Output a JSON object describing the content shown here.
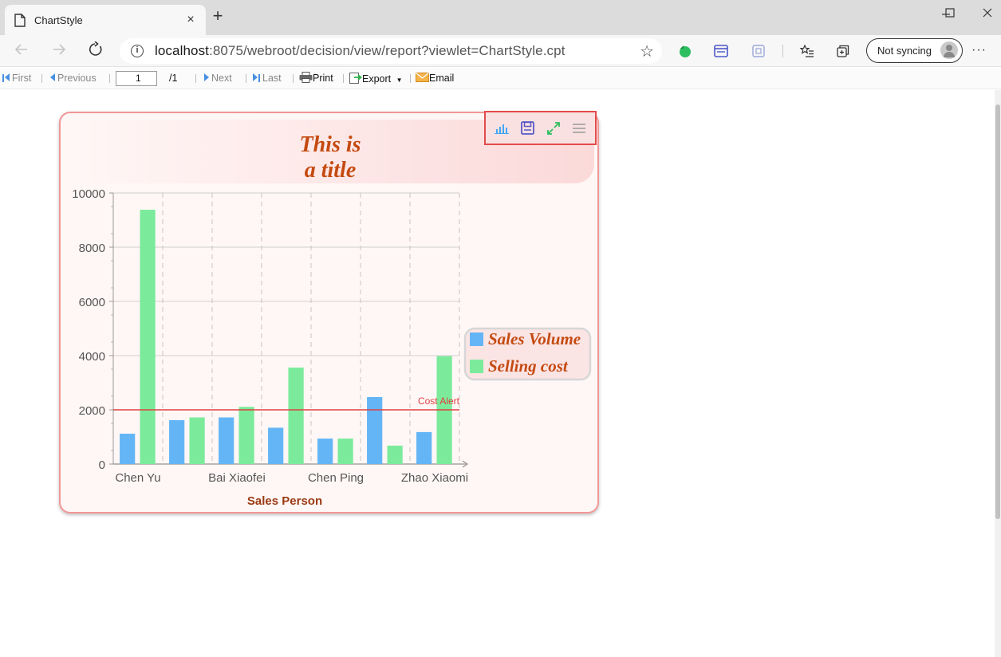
{
  "browser": {
    "tab_title": "ChartStyle",
    "tab_close": "×",
    "new_tab": "+",
    "address_host": "localhost",
    "address_path": ":8075/webroot/decision/view/report?viewlet=ChartStyle.cpt",
    "sync_label": "Not syncing",
    "more": "···",
    "win_min": "—",
    "win_max": "☐",
    "win_close": "✕"
  },
  "report_toolbar": {
    "first": "First",
    "previous": "Previous",
    "page_value": "1",
    "page_total": "/1",
    "next": "Next",
    "last": "Last",
    "print": "Print",
    "export": "Export",
    "email": "Email"
  },
  "colors": {
    "sales_volume": "#64b5f6",
    "selling_cost": "#7beb9b",
    "title": "#c44a10",
    "alert_line": "#e04040",
    "frame_border": "#f19797"
  },
  "chart_tools": [
    "bar-chart-icon",
    "save-icon",
    "fullscreen-icon",
    "menu-icon"
  ],
  "chart_data": {
    "type": "bar",
    "title_lines": [
      "This is",
      "a title"
    ],
    "xlabel": "Sales Person",
    "ylabel": "",
    "categories": [
      "Chen Yu",
      "",
      "Bai Xiaofei",
      "",
      "Chen Ping",
      "",
      "Zhao Xiaomi"
    ],
    "tick_labels": [
      "Chen Yu",
      "Bai Xiaofei",
      "Chen Ping",
      "Zhao Xiaomi"
    ],
    "y_ticks": [
      "0",
      "2000",
      "4000",
      "6000",
      "8000",
      "10000"
    ],
    "ylim": [
      0,
      10000
    ],
    "series": [
      {
        "name": "Sales Volume",
        "values": [
          1120,
          1620,
          1720,
          1340,
          940,
          2470,
          1180
        ]
      },
      {
        "name": "Selling cost",
        "values": [
          9380,
          1720,
          2110,
          3560,
          940,
          680,
          3980
        ]
      }
    ],
    "reference_line": {
      "label": "Cost Alert",
      "value": 2000
    },
    "grid": true,
    "legend_position": "right"
  }
}
